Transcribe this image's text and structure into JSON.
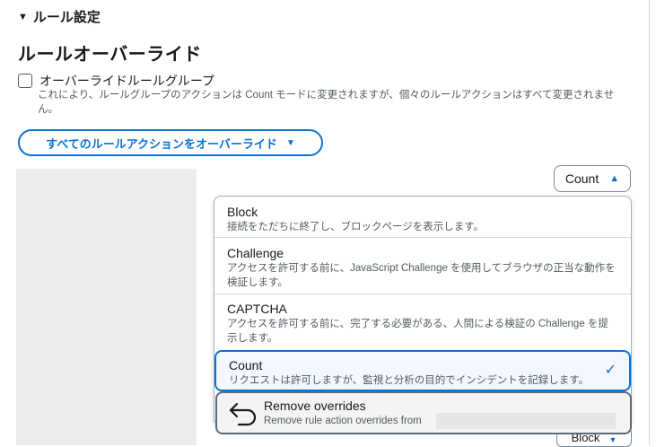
{
  "section": {
    "caret": "▼",
    "title": "ルール設定"
  },
  "override": {
    "heading": "ルールオーバーライド",
    "checkbox_label": "オーバーライドルールグループ",
    "description": "これにより、ルールグループのアクションは Count モードに変更されますが、個々のルールアクションはすべて変更されません。",
    "all_actions_button": "すべてのルールアクションをオーバーライド"
  },
  "select": {
    "value": "Count",
    "bottom_value": "Block"
  },
  "dropdown": {
    "options": [
      {
        "label": "Block",
        "description": "接続をただちに終了し、ブロックページを表示します。"
      },
      {
        "label": "Challenge",
        "description": "アクセスを許可する前に、JavaScript Challenge を使用してブラウザの正当な動作を検証します。"
      },
      {
        "label": "CAPTCHA",
        "description": "アクセスを許可する前に、完了する必要がある、人間による検証の Challenge を提示します。"
      },
      {
        "label": "Count",
        "description": "リクエストは許可しますが、監視と分析の目的でインシデントを記録します。",
        "selected": true
      }
    ],
    "remove": {
      "label": "Remove overrides",
      "description": "Remove rule action overrides from"
    }
  },
  "colors": {
    "accent": "#0972d3",
    "text": "#16191f",
    "muted": "#545b64"
  }
}
